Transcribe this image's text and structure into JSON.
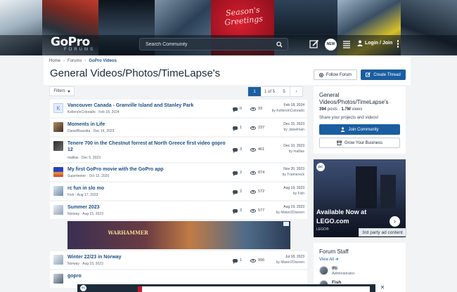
{
  "header": {
    "logo_main": "GoPro",
    "logo_sub": "FORUMS",
    "banner_greeting": "Season's Greetings",
    "search_placeholder": "Search Community",
    "new_badge": "NEW",
    "login_label": "Login / Join"
  },
  "breadcrumbs": [
    "Home",
    "Forums",
    "GoPro Videos"
  ],
  "page": {
    "title": "General Videos/Photos/TimeLapse's",
    "follow_label": "Follow Forum",
    "create_label": "Create Thread"
  },
  "toolbar": {
    "filters_label": "Filters",
    "pager_current": "1",
    "pager_of": "1 of 5",
    "pager_last": "5",
    "pager_next": "›"
  },
  "threads": [
    {
      "avatar": "K",
      "title": "Vancouver Canada - Granville Island and Stanley Park",
      "author": "KellersInColorado",
      "date": "Feb 18, 2024",
      "replies": "0",
      "views": "93",
      "last_date": "Feb 18, 2024",
      "last_by": "by KellersInColorado"
    },
    {
      "avatar": "",
      "title": "Moments in Life",
      "author": "DanielBoavida",
      "date": "Dec 14, 2023",
      "replies": "1",
      "views": "237",
      "last_date": "Dec 15, 2023",
      "last_by": "by Jatselman"
    },
    {
      "avatar": "",
      "title": "Tenere 700 in the Chestnut forrest at North Greece first video gopro 12",
      "author": "mallias",
      "date": "Dec 5, 2023",
      "replies": "3",
      "views": "461",
      "last_date": "Dec 10, 2023",
      "last_by": "by mallias"
    },
    {
      "avatar": "",
      "title": "My first GoPro movie with the GoPro app",
      "author": "Superteeter",
      "date": "Oct 13, 2020",
      "replies": "2",
      "views": "874",
      "last_date": "Nov 20, 2023",
      "last_by": "by Traimereck"
    },
    {
      "avatar": "",
      "title": "rc fun in slo mo",
      "author": "Fish",
      "date": "Aug 17, 2023",
      "replies": "2",
      "views": "572",
      "last_date": "Aug 19, 2023",
      "last_by": "by Fish"
    },
    {
      "avatar": "",
      "title": "Summer 2023",
      "author": "Norway",
      "date": "Aug 15, 2023",
      "replies": "3",
      "views": "577",
      "last_date": "Aug 19, 2023",
      "last_by": "by Mister2Oseven"
    },
    {
      "avatar": "",
      "title": "Winter 22/23 in Norway",
      "author": "Norway",
      "date": "Aug 15, 2023",
      "replies": "1",
      "views": "996",
      "last_date": "Jul 18, 2023",
      "last_by": "by Mister2Oseven"
    },
    {
      "avatar": "",
      "title": "gopro",
      "author": "",
      "date": "",
      "replies": "",
      "views": "",
      "last_date": "",
      "last_by": ""
    }
  ],
  "inline_ad": {
    "wordmark": "WARHAMMER"
  },
  "sidebar": {
    "forum_title": "General Videos/Photos/TimeLapse's",
    "posts": "394",
    "posts_label": "posts",
    "views": "1.7M",
    "views_label": "views",
    "description": "Share your projects and videos!",
    "join_label": "Join Community",
    "grow_label": "Grow Your Business",
    "ad": {
      "brand": "DC",
      "line1": "Available Now at",
      "line2": "LEGO.com",
      "small": "LEGO®"
    },
    "tooltip": "3rd party ad content",
    "staff_title": "Forum Staff",
    "staff_view_all": "View All",
    "staff": [
      {
        "name": "Ifti",
        "role": "Administrator"
      },
      {
        "name": "Fish",
        "role": ""
      }
    ]
  },
  "bottom_ad": {
    "brand": "DC",
    "close": "✕"
  }
}
